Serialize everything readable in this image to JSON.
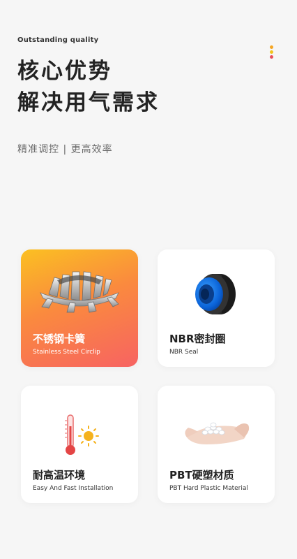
{
  "header": {
    "eyebrow": "Outstanding quality",
    "headline_line1": "核心优势",
    "headline_line2": "解决用气需求",
    "subline": "精准调控 | 更高效率",
    "dot_colors": [
      "#f5a623",
      "#f2c41b",
      "#e8505b"
    ]
  },
  "features": [
    {
      "title": "不锈钢卡簧",
      "subtitle": "Stainless Steel Circlip",
      "icon": "circlip-icon",
      "selected": true
    },
    {
      "title": "NBR密封圈",
      "subtitle": "NBR Seal",
      "icon": "seal-ring-icon",
      "selected": false
    },
    {
      "title": "耐高温环境",
      "subtitle": "Easy And Fast Installation",
      "icon": "thermometer-sun-icon",
      "selected": false
    },
    {
      "title": "PBT硬塑材质",
      "subtitle": "PBT Hard Plastic Material",
      "icon": "plastic-pellets-hand-icon",
      "selected": false
    }
  ],
  "colors": {
    "background": "#f6f6f6",
    "card": "#ffffff",
    "active_gradient": [
      "#fbc022",
      "#fa8a3e",
      "#f76362"
    ]
  }
}
